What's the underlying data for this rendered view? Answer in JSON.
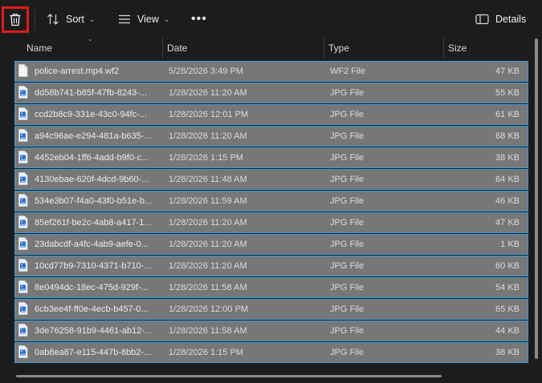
{
  "toolbar": {
    "sort_label": "Sort",
    "view_label": "View",
    "more_label": "•••",
    "details_label": "Details"
  },
  "columns": {
    "name": "Name",
    "date": "Date",
    "type": "Type",
    "size": "Size"
  },
  "files": [
    {
      "name": "police-arrest.mp4.wf2",
      "date": "5/28/2026 3:49 PM",
      "type": "WF2 File",
      "size": "47 KB",
      "icon": "document-icon"
    },
    {
      "name": "dd58b741-b85f-47fb-8243-...",
      "date": "1/28/2026 11:20 AM",
      "type": "JPG File",
      "size": "55 KB",
      "icon": "image-file-icon"
    },
    {
      "name": "ccd2b8c9-331e-43c0-94fc-...",
      "date": "1/28/2026 12:01 PM",
      "type": "JPG File",
      "size": "61 KB",
      "icon": "image-file-icon"
    },
    {
      "name": "a94c96ae-e294-481a-b635-...",
      "date": "1/28/2026 11:20 AM",
      "type": "JPG File",
      "size": "68 KB",
      "icon": "image-file-icon"
    },
    {
      "name": "4452eb04-1ff6-4add-b9f0-c...",
      "date": "1/28/2026 1:15 PM",
      "type": "JPG File",
      "size": "38 KB",
      "icon": "image-file-icon"
    },
    {
      "name": "4130ebae-620f-4dcd-9b60-...",
      "date": "1/28/2026 11:48 AM",
      "type": "JPG File",
      "size": "64 KB",
      "icon": "image-file-icon"
    },
    {
      "name": "534e3b07-f4a0-43f0-b51e-b...",
      "date": "1/28/2026 11:59 AM",
      "type": "JPG File",
      "size": "46 KB",
      "icon": "image-file-icon"
    },
    {
      "name": "85ef261f-be2c-4ab8-a417-1...",
      "date": "1/28/2026 11:20 AM",
      "type": "JPG File",
      "size": "47 KB",
      "icon": "image-file-icon"
    },
    {
      "name": "23dabcdf-a4fc-4ab9-aefe-0...",
      "date": "1/28/2026 11:20 AM",
      "type": "JPG File",
      "size": "1 KB",
      "icon": "image-file-icon"
    },
    {
      "name": "10cd77b9-7310-4371-b710-...",
      "date": "1/28/2026 11:20 AM",
      "type": "JPG File",
      "size": "60 KB",
      "icon": "image-file-icon"
    },
    {
      "name": "8e0494dc-18ec-475d-929f-...",
      "date": "1/28/2026 11:58 AM",
      "type": "JPG File",
      "size": "54 KB",
      "icon": "image-file-icon"
    },
    {
      "name": "6cb3ee4f-ff0e-4ecb-b457-0...",
      "date": "1/28/2026 12:00 PM",
      "type": "JPG File",
      "size": "65 KB",
      "icon": "image-file-icon"
    },
    {
      "name": "3de76258-91b9-4461-ab12-...",
      "date": "1/28/2026 11:58 AM",
      "type": "JPG File",
      "size": "44 KB",
      "icon": "image-file-icon"
    },
    {
      "name": "0ab8ea87-e115-447b-8bb2-...",
      "date": "1/28/2026 1:15 PM",
      "type": "JPG File",
      "size": "38 KB",
      "icon": "image-file-icon"
    }
  ],
  "colors": {
    "selection_border": "#3e9bd6",
    "selection_fill": "#777777",
    "highlight_box": "#e01b1b"
  }
}
